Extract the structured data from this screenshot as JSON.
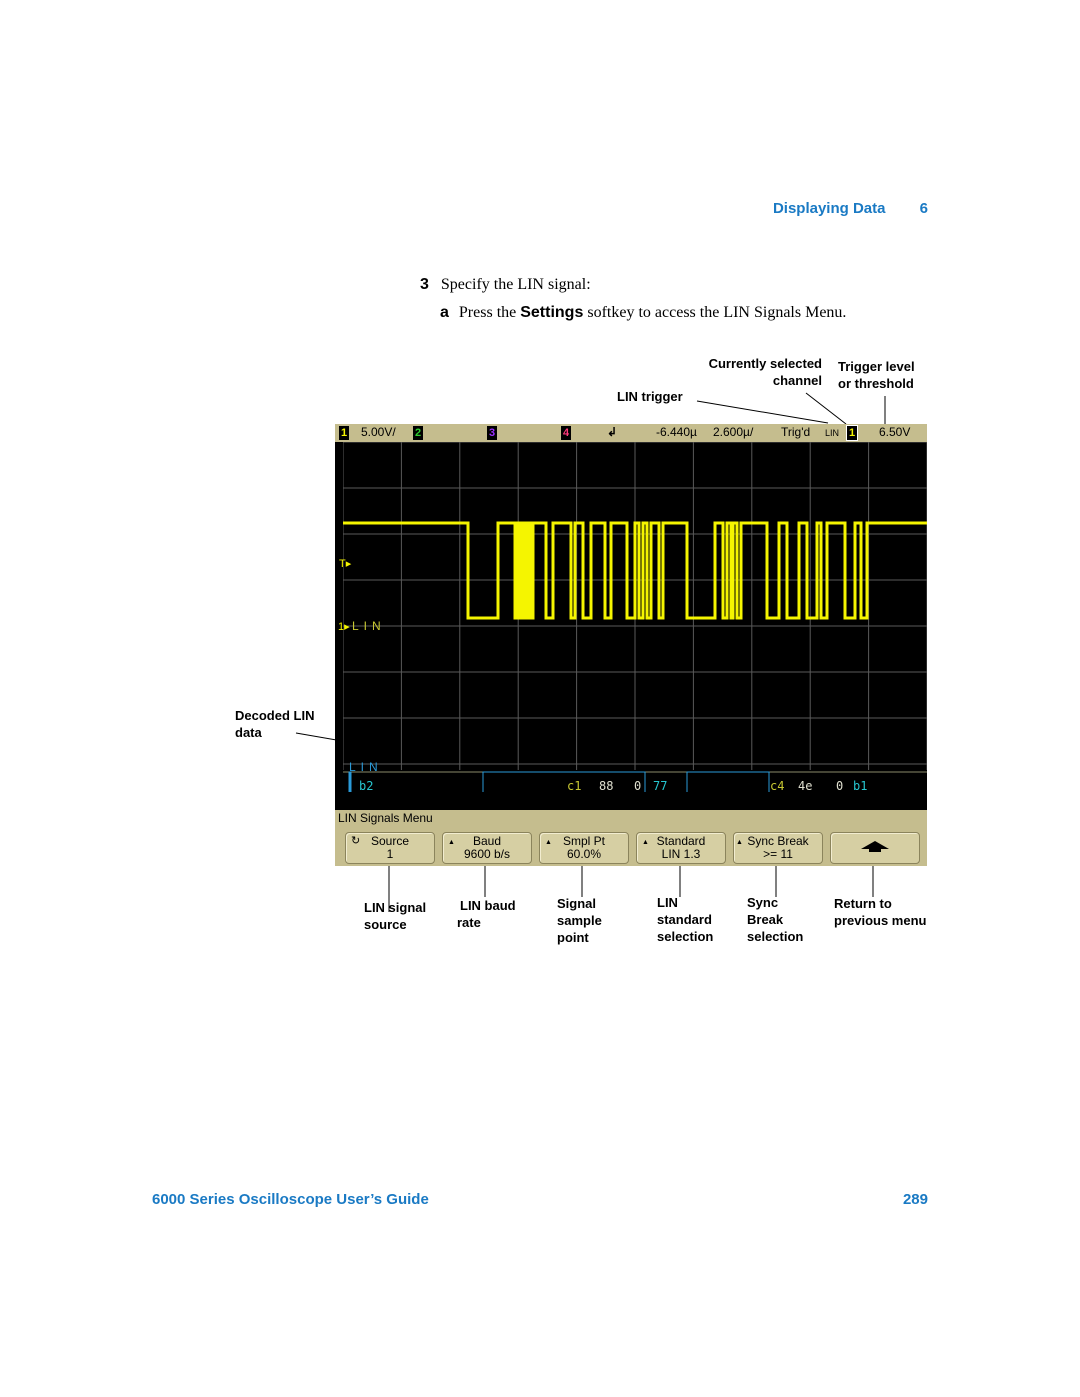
{
  "header": {
    "section": "Displaying Data",
    "chapter": "6"
  },
  "instructions": {
    "step_number": "3",
    "step_text": "Specify the LIN signal:",
    "substep_letter": "a",
    "substep_pre": "Press the ",
    "substep_bold": "Settings",
    "substep_post": " softkey to access the LIN Signals Menu."
  },
  "callouts": {
    "lin_trigger": "LIN trigger",
    "current_channel_1": "Currently selected",
    "current_channel_2": "channel",
    "trigger_level_1": "Trigger level",
    "trigger_level_2": "or threshold",
    "decoded_1": "Decoded LIN",
    "decoded_2": "data",
    "source_1": "LIN signal",
    "source_2": "source",
    "baud_1": "LIN baud",
    "baud_2": "rate",
    "smpl_1": "Signal",
    "smpl_2": "sample",
    "smpl_3": "point",
    "std_1": "LIN",
    "std_2": "standard",
    "std_3": "selection",
    "sync_1": "Sync",
    "sync_2": "Break",
    "sync_3": "selection",
    "ret_1": "Return to",
    "ret_2": "previous menu"
  },
  "scope": {
    "status": {
      "ch1_label": "1",
      "ch1_scale": "5.00V/",
      "ch2_label": "2",
      "ch3_label": "3",
      "ch4_label": "4",
      "delay": "-6.440µ",
      "timebase": "2.600µ/",
      "trig_state": "Trig'd",
      "trig_type": "LIN",
      "trig_channel": "1",
      "trig_level": "6.50V"
    },
    "colors": {
      "ch1": "#f5f500",
      "ch2": "#2ecc2e",
      "ch3": "#9b30ff",
      "ch4": "#ff3a7a",
      "decode": "#2a9ad8",
      "decode_text_cyan": "#27c6d0",
      "decode_text_yellow": "#c8c832",
      "decode_text_white": "#e0e0d0",
      "grid": "#5a5a5a"
    },
    "waveform_label": "LIN",
    "trigger_marker": "T",
    "ground_marker": "1",
    "decode_label": "LIN",
    "decode_frames": [
      {
        "id": "b2"
      },
      {
        "id": "c1",
        "data": "88",
        "d2": "0",
        "checksum": "77"
      },
      {
        "id": "c4",
        "data": "4e",
        "d2": "0",
        "checksum": "b1"
      }
    ],
    "menu": {
      "title": "LIN Signals Menu",
      "softkeys": [
        {
          "label": "Source",
          "value": "1",
          "icon": "rotary-knob-icon"
        },
        {
          "label": "Baud",
          "value": "9600 b/s",
          "icon": "triangle-up-icon"
        },
        {
          "label": "Smpl Pt",
          "value": "60.0%",
          "icon": "triangle-up-icon"
        },
        {
          "label": "Standard",
          "value": "LIN 1.3",
          "icon": "triangle-up-icon"
        },
        {
          "label": "Sync Break",
          "value": ">= 11",
          "icon": "triangle-up-icon"
        },
        {
          "label": "",
          "value": "",
          "icon": "return-arrow-icon"
        }
      ]
    }
  },
  "footer": {
    "title": "6000 Series Oscilloscope User’s Guide",
    "page": "289"
  }
}
